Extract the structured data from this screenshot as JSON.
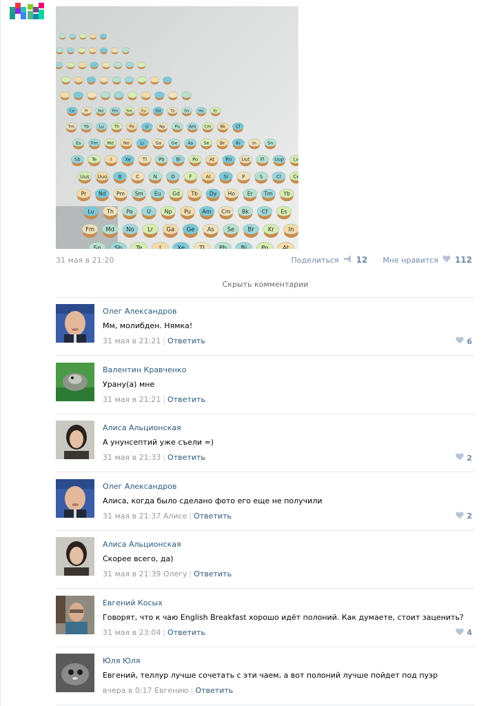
{
  "post": {
    "date": "31 мая в 21:20",
    "share_label": "Поделиться",
    "share_count": "12",
    "like_label": "Мне нравится",
    "like_count": "112"
  },
  "hide_comments": "Скрыть комментарии",
  "comments": [
    {
      "author": "Олег Александров",
      "text": "Мм, молибден. Нямка!",
      "date": "31 мая в 21:21",
      "reply_to": "",
      "reply": "Ответить",
      "likes": "6"
    },
    {
      "author": "Валентин Кравченко",
      "text": "Урану(а) мне",
      "date": "31 мая в 21:21",
      "reply_to": "",
      "reply": "Ответить",
      "likes": ""
    },
    {
      "author": "Алиса Альционская",
      "text": "А унунсептий уже съели =)",
      "date": "31 мая в 21:33",
      "reply_to": "",
      "reply": "Ответить",
      "likes": "2"
    },
    {
      "author": "Олег Александров",
      "text": "Алиса, когда было сделано фото его еще не получили",
      "date": "31 мая в 21:37",
      "reply_to": "Алисе",
      "reply": "Ответить",
      "likes": "2"
    },
    {
      "author": "Алиса Альционская",
      "text": "Скорее всего, да)",
      "date": "31 мая в 21:39",
      "reply_to": "Олегу",
      "reply": "Ответить",
      "likes": ""
    },
    {
      "author": "Евгений Косых",
      "text": "Говорят, что к чаю English Breakfast хорошо идёт полоний. Как думаете, стоит заценить?",
      "date": "31 мая в 23:04",
      "reply_to": "",
      "reply": "Ответить",
      "likes": "4"
    },
    {
      "author": "Юля Юля",
      "text": "Евгений, теллур лучше сочетать с эти чаем, а вот полоний лучше пойдет под пуэр",
      "date": "вчера в 0:17",
      "reply_to": "Евгению",
      "reply": "Ответить",
      "likes": ""
    }
  ],
  "cupcake_labels": [
    "Ce",
    "Pr",
    "Nd",
    "Pm",
    "Sm",
    "Eu",
    "Gd",
    "Tb",
    "Dy",
    "Ho",
    "Er",
    "Tm",
    "Yb",
    "Lu",
    "Th",
    "Pa",
    "U",
    "Np",
    "Pu",
    "Am",
    "Cm",
    "Bk",
    "Cf",
    "Es",
    "Fm",
    "Md",
    "No",
    "Lr",
    "Ga",
    "Ge",
    "As",
    "Se",
    "Br",
    "Kr",
    "In",
    "Sn",
    "Sb",
    "Te",
    "I",
    "Xe",
    "Tl",
    "Pb",
    "Bi",
    "Po",
    "At",
    "Rn",
    "Uut",
    "Fl",
    "Uup",
    "Lv",
    "Uus",
    "Uuo",
    "B",
    "C",
    "N",
    "O",
    "F",
    "Al",
    "Si",
    "P",
    "S",
    "Cl"
  ],
  "colors": {
    "link": "#2b587a",
    "meta": "#999999",
    "accent": "#6f8aa8",
    "divider": "#e4e8ec"
  }
}
